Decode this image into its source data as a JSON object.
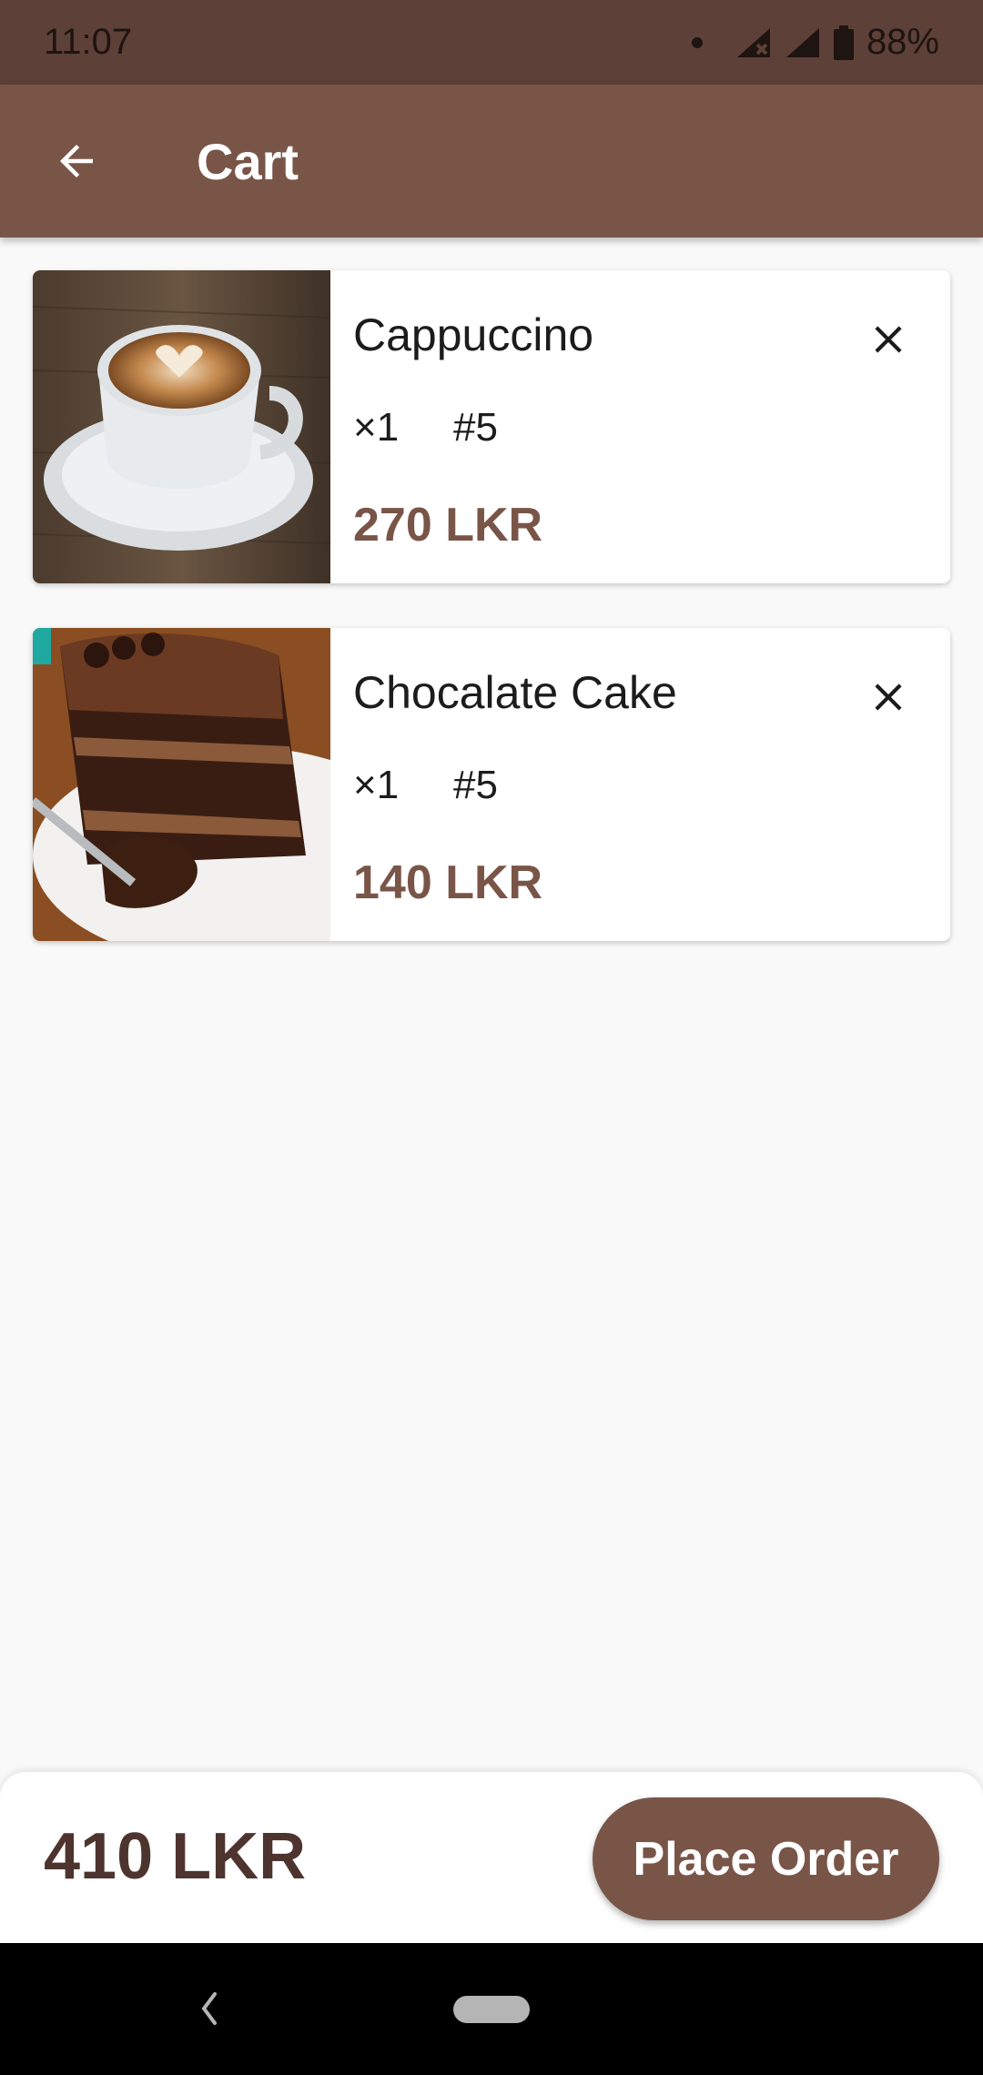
{
  "status_bar": {
    "time": "11:07",
    "battery": "88%",
    "icons": [
      "notification-dot-icon",
      "signal-no-sim-icon",
      "signal-icon",
      "battery-icon"
    ]
  },
  "app_bar": {
    "title": "Cart",
    "back_icon": "arrow-back-icon",
    "color": "#795548"
  },
  "cart": {
    "items": [
      {
        "name": "Cappuccino",
        "quantity": "×1",
        "table": "#5",
        "price": "270 LKR",
        "image": "cappuccino-photo",
        "remove_icon": "close-icon"
      },
      {
        "name": "Chocalate Cake",
        "quantity": "×1",
        "table": "#5",
        "price": "140 LKR",
        "image": "chocolate-cake-photo",
        "remove_icon": "close-icon"
      }
    ]
  },
  "footer": {
    "total": "410 LKR",
    "place_order_label": "Place Order"
  },
  "nav_bar": {
    "icons": [
      "nav-back-icon",
      "home-pill-icon"
    ]
  },
  "colors": {
    "status_bar": "#5d4037",
    "primary": "#795548",
    "total_text": "#4e342e",
    "background": "#f9f9f9"
  }
}
